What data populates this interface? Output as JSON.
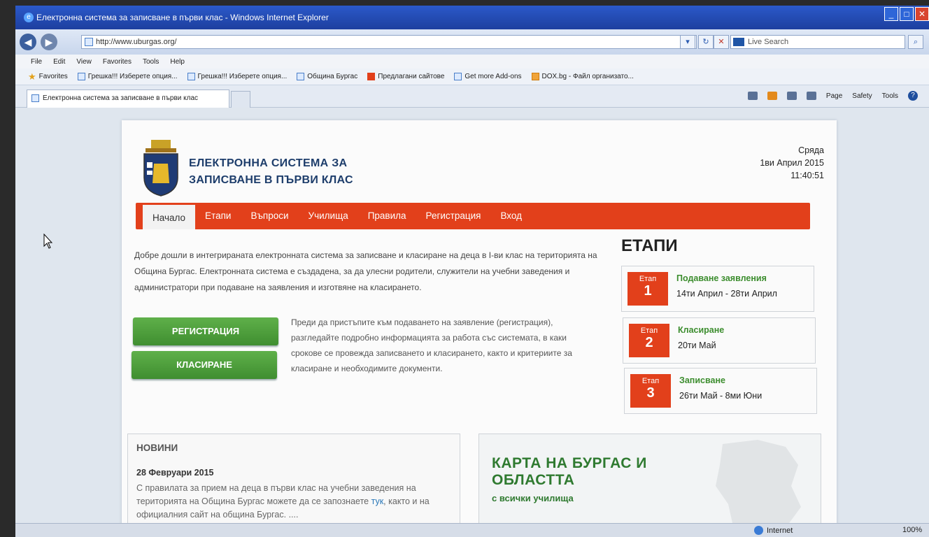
{
  "browser": {
    "window_title": "Електронна система за записване в първи клас - Windows Internet Explorer",
    "url": "http://www.uburgas.org/",
    "search_placeholder": "Live Search",
    "menu": [
      "File",
      "Edit",
      "View",
      "Favorites",
      "Tools",
      "Help"
    ],
    "favorites_label": "Favorites",
    "favorites": [
      "Грешка!!! Изберете опция...",
      "Грешка!!! Изберете опция...",
      "Община Бургас",
      "Предлагани сайтове",
      "Get more Add-ons",
      "DOX.bg - Файл организато..."
    ],
    "tab_title": "Електронна система за записване в първи клас",
    "commands": {
      "page": "Page",
      "safety": "Safety",
      "tools": "Tools"
    },
    "status": {
      "zone": "Internet",
      "zoom": "100%"
    }
  },
  "site": {
    "title_line1": "ЕЛЕКТРОННА СИСТЕМА ЗА",
    "title_line2": "ЗАПИСВАНЕ В ПЪРВИ КЛАС",
    "day": "Сряда",
    "date": "1ви Април 2015",
    "time": "11:40:51",
    "nav": [
      "Начало",
      "Етапи",
      "Въпроси",
      "Училища",
      "Правила",
      "Регистрация",
      "Вход"
    ],
    "intro": "Добре дошли в интегрираната електронната система за записване и класиране на деца в I-ви клас на територията на Община Бургас. Електронната система е създадена, за да улесни родители, служители на учебни заведения и администратори при подаване на заявления и изготвяне на класирането.",
    "btn_register": "РЕГИСТРАЦИЯ",
    "btn_ranking": "КЛАСИРАНЕ",
    "side_text": "Преди да пристъпите към подаването на заявление (регистрация), разгледайте подробно информацията за работа със системата, в каки срокове се провежда записването и класирането, както и критериите за класиране и необходимите документи.",
    "stages_heading": "ЕТАПИ",
    "stages": [
      {
        "label": "Етап",
        "num": "1",
        "title": "Подаване заявления",
        "dates": "14ти Април - 28ти Април"
      },
      {
        "label": "Етап",
        "num": "2",
        "title": "Класиране",
        "dates": "20ти Май"
      },
      {
        "label": "Етап",
        "num": "3",
        "title": "Записване",
        "dates": "26ти Май - 8ми Юни"
      }
    ],
    "news": {
      "heading": "НОВИНИ",
      "date": "28 Февруари 2015",
      "text_before": "С правилата за прием на деца в първи клас на учебни заведения на територията на Община Бургас можете да се запознаете ",
      "link": "тук",
      "text_after": ", както и на официалния сайт на община Бургас. ...."
    },
    "map": {
      "title_line1": "КАРТА НА БУРГАС И",
      "title_line2": "ОБЛАСТТА",
      "subtitle": "с всички училища"
    }
  }
}
